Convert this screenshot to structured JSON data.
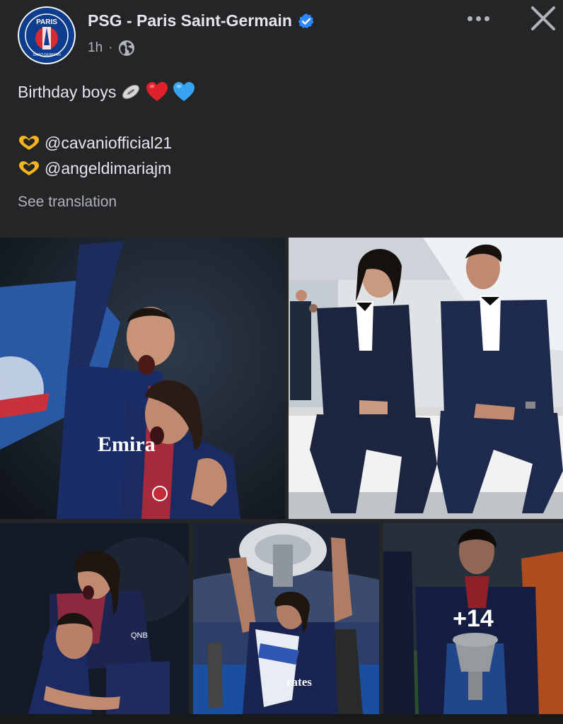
{
  "header": {
    "page_name": "PSG - Paris Saint-Germain",
    "timestamp": "1h",
    "avatar_text": "PARIS",
    "avatar_subtext": "SAINT-GERMAIN"
  },
  "post": {
    "title_line": "Birthday boys",
    "mention_1": "@cavaniofficial21",
    "mention_2": "@angeldimariajm",
    "see_translation": "See translation"
  },
  "gallery": {
    "more_count": "+14",
    "photo_jersey_text_1": "Emira",
    "photo_jersey_text_2": "rates"
  },
  "icons": {
    "verified": "verified-badge-icon",
    "privacy": "globe-icon",
    "more": "more-options-icon",
    "close": "close-icon",
    "emoji_1": "rugby-ball-emoji",
    "emoji_2": "red-heart-emoji",
    "emoji_3": "blue-heart-emoji",
    "emoji_heart_hands": "heart-hands-emoji"
  },
  "colors": {
    "background": "#242526",
    "primary_text": "#e4e6eb",
    "secondary_text": "#b0b3b8",
    "verified": "#2d88ff",
    "psg_blue": "#0d3d8c",
    "psg_red": "#d62b35"
  }
}
